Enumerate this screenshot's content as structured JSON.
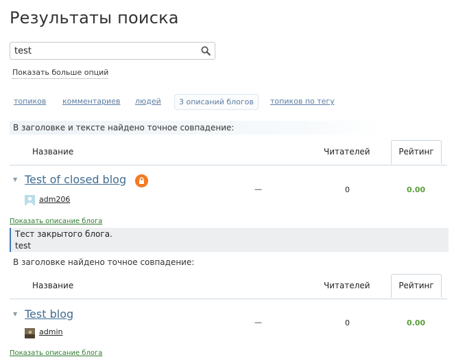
{
  "page": {
    "title": "Результаты поиска"
  },
  "search": {
    "value": "test",
    "more_options": "Показать больше опций"
  },
  "tabs": [
    {
      "label": "топиков"
    },
    {
      "label": "комментариев"
    },
    {
      "label": "людей"
    },
    {
      "label": "3 описаний блогов"
    },
    {
      "label": "топиков по тегу"
    }
  ],
  "sections": [
    {
      "title": "В заголовке и тексте найдено точное совпадение:",
      "head": {
        "name": "Название",
        "readers": "Читателей",
        "rating": "Рейтинг"
      },
      "blog": {
        "name": "Test of closed blog",
        "user": "adm206",
        "dash": "—",
        "readers": "0",
        "rating": "0.00",
        "show_desc": "Показать описание блога",
        "desc_lines": [
          "Тест закрытого блога.",
          "test"
        ]
      }
    },
    {
      "title": "В заголовке найдено точное совпадение:",
      "head": {
        "name": "Название",
        "readers": "Читателей",
        "rating": "Рейтинг"
      },
      "blog": {
        "name": "Test blog",
        "user": "admin",
        "dash": "—",
        "readers": "0",
        "rating": "0.00",
        "show_desc": "Показать описание блога"
      }
    }
  ],
  "colors": {
    "link": "#3f6b8f",
    "rating": "#5a9e3a",
    "lock_badge": "#f47b20",
    "desc_border": "#3f78b6"
  },
  "icons": {
    "search": "magnifier-icon",
    "lock": "lock-icon",
    "expand": "triangle-down-icon"
  }
}
